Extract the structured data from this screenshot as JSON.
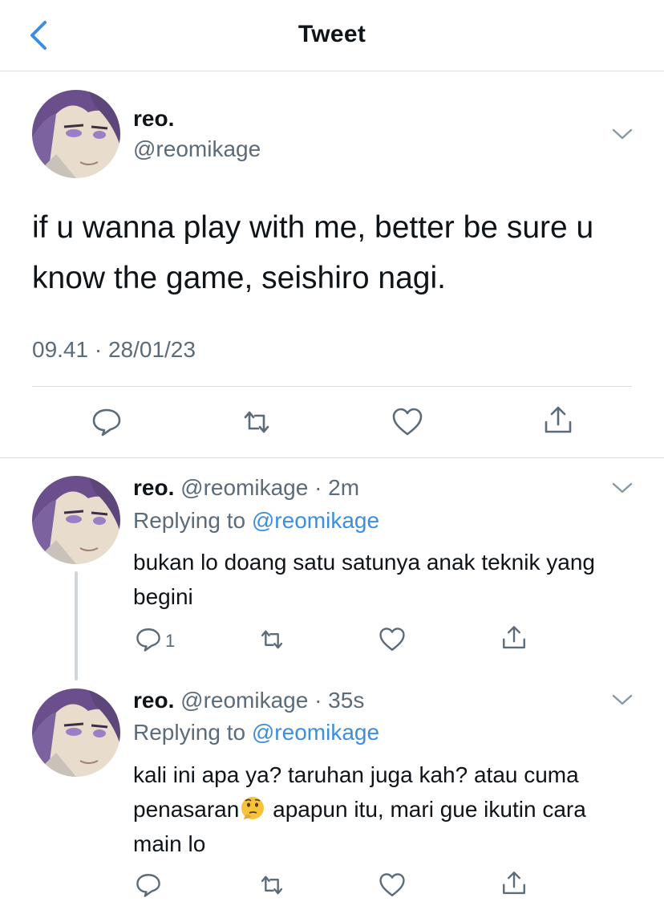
{
  "header": {
    "title": "Tweet",
    "back_icon": "chevron-left-icon"
  },
  "main_tweet": {
    "name": "reo.",
    "handle": "@reomikage",
    "text": "if u wanna play with me, better be sure u know the game, seishiro nagi.",
    "timestamp": "09.41 · 28/01/23"
  },
  "replies": [
    {
      "name": "reo.",
      "handle_time": "@reomikage · 2m",
      "replying_prefix": "Replying to",
      "replying_to": "@reomikage",
      "text": "bukan lo doang satu satunya anak teknik yang begini",
      "reply_count": "1"
    },
    {
      "name": "reo.",
      "handle_time": "@reomikage · 35s",
      "replying_prefix": "Replying to",
      "replying_to": "@reomikage",
      "text_before": "kali ini apa ya? taruhan juga kah? atau cuma penasaran",
      "emoji": "thinking-face",
      "text_after": " apapun itu, mari gue ikutin cara main lo"
    }
  ],
  "colors": {
    "accent": "#3b8fe0",
    "secondary_text": "#5b6b79",
    "divider": "#d8dce0"
  }
}
